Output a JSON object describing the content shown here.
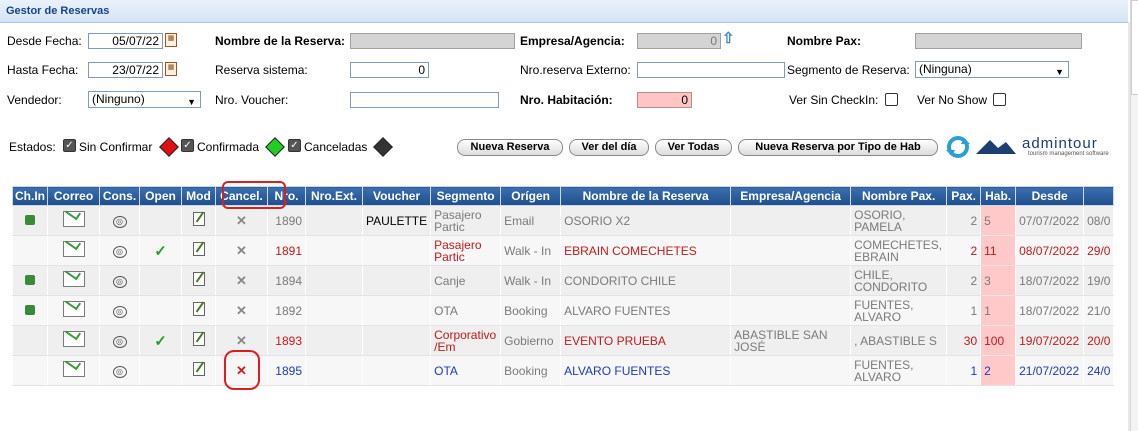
{
  "title": "Gestor de Reservas",
  "filters": {
    "desde_fecha_label": "Desde Fecha:",
    "desde_fecha": "05/07/22",
    "hasta_fecha_label": "Hasta Fecha:",
    "hasta_fecha": "23/07/22",
    "vendedor_label": "Vendedor:",
    "vendedor": "(Ninguno)",
    "nombre_reserva_label": "Nombre de la Reserva:",
    "nombre_reserva": "",
    "reserva_sistema_label": "Reserva sistema:",
    "reserva_sistema": "0",
    "nro_voucher_label": "Nro. Voucher:",
    "nro_voucher": "",
    "empresa_label": "Empresa/Agencia:",
    "empresa": "0",
    "nro_externo_label": "Nro.reserva Externo:",
    "nro_externo": "",
    "nro_habitacion_label": "Nro. Habitación:",
    "nro_habitacion": "0",
    "nombre_pax_label": "Nombre Pax:",
    "nombre_pax": "",
    "segmento_label": "Segmento de Reserva:",
    "segmento": "(Ninguna)",
    "ver_sin_checkin_label": "Ver Sin CheckIn:",
    "ver_no_show_label": "Ver No Show"
  },
  "estados": {
    "label": "Estados:",
    "sin_confirmar": "Sin Confirmar",
    "confirmada": "Confirmada",
    "canceladas": "Canceladas",
    "colors": {
      "sin_confirmar": "#e01010",
      "confirmada": "#22cc22",
      "canceladas": "#333333"
    }
  },
  "buttons": {
    "nueva_reserva": "Nueva Reserva",
    "ver_del_dia": "Ver del día",
    "ver_todas": "Ver Todas",
    "nueva_por_tipo": "Nueva Reserva por Tipo de Hab"
  },
  "logo": {
    "name": "admintour",
    "tagline": "tourism management software"
  },
  "table": {
    "headers": [
      "Ch.In",
      "Correo",
      "Cons.",
      "Open",
      "Mod",
      "Cancel.",
      "Nro.",
      "Nro.Ext.",
      "Voucher",
      "Segmento",
      "Orígen",
      "Nombre de la Reserva",
      "Empresa/Agencia",
      "Nombre Pax.",
      "Pax.",
      "Hab.",
      "Desde",
      ""
    ],
    "rows": [
      {
        "chin": true,
        "open": false,
        "cancel_red": false,
        "nro": "1890",
        "voucher": "PAULETTE",
        "segmento": "Pasajero Partic",
        "origen": "Email",
        "nombre": "OSORIO X2",
        "empresa": "",
        "pax_name": "OSORIO, PAMELA",
        "pax": "2",
        "hab": "5",
        "desde": "07/07/2022",
        "hasta": "08/0",
        "color": "gray"
      },
      {
        "chin": false,
        "open": true,
        "cancel_red": false,
        "nro": "1891",
        "voucher": "",
        "segmento": "Pasajero Partic",
        "origen": "Walk - In",
        "nombre": "EBRAIN COMECHETES",
        "empresa": "",
        "pax_name": "COMECHETES, EBRAIN",
        "pax": "2",
        "hab": "11",
        "desde": "08/07/2022",
        "hasta": "29/0",
        "color": "red"
      },
      {
        "chin": true,
        "open": false,
        "cancel_red": false,
        "nro": "1894",
        "voucher": "",
        "segmento": "Canje",
        "origen": "Walk - In",
        "nombre": "CONDORITO CHILE",
        "empresa": "",
        "pax_name": "CHILE, CONDORITO",
        "pax": "2",
        "hab": "3",
        "desde": "18/07/2022",
        "hasta": "19/0",
        "color": "gray"
      },
      {
        "chin": true,
        "open": false,
        "cancel_red": false,
        "nro": "1892",
        "voucher": "",
        "segmento": "OTA",
        "origen": "Booking",
        "nombre": "ALVARO FUENTES",
        "empresa": "",
        "pax_name": "FUENTES, ALVARO",
        "pax": "1",
        "hab": "1",
        "desde": "18/07/2022",
        "hasta": "21/0",
        "color": "gray"
      },
      {
        "chin": false,
        "open": true,
        "cancel_red": false,
        "nro": "1893",
        "voucher": "",
        "segmento": "Corporativo /Em",
        "origen": "Gobierno",
        "nombre": "EVENTO PRUEBA",
        "empresa": "ABASTIBLE SAN JOSÉ",
        "pax_name": ", ABASTIBLE S",
        "pax": "30",
        "hab": "100",
        "desde": "19/07/2022",
        "hasta": "20/0",
        "color": "red"
      },
      {
        "chin": false,
        "open": false,
        "cancel_red": true,
        "nro": "1895",
        "voucher": "",
        "segmento": "OTA",
        "origen": "Booking",
        "nombre": "ALVARO FUENTES",
        "empresa": "",
        "pax_name": "FUENTES, ALVARO",
        "pax": "1",
        "hab": "2",
        "desde": "21/07/2022",
        "hasta": "24/0",
        "color": "blue"
      }
    ]
  }
}
